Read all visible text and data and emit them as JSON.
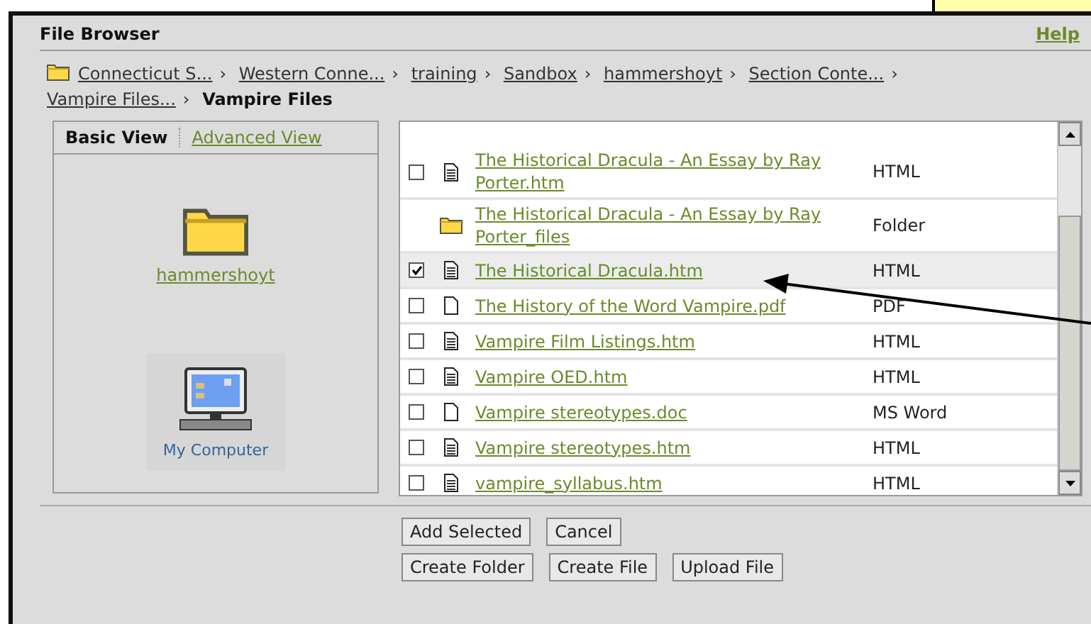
{
  "window": {
    "title": "File Browser",
    "help_link": "Help"
  },
  "breadcrumb": {
    "items": [
      "Connecticut S...",
      "Western Conne...",
      "training",
      "Sandbox",
      "hammershoyt",
      "Section Conte...",
      "Vampire Files..."
    ],
    "separators": [
      "›",
      "›",
      "›",
      "›",
      "›",
      "›",
      "›"
    ],
    "current": "Vampire Files"
  },
  "view_tabs": [
    {
      "label": "Basic View",
      "selected": true
    },
    {
      "label": "Advanced View",
      "selected": false
    }
  ],
  "places": [
    {
      "kind": "folder",
      "label": "hammershoyt"
    },
    {
      "kind": "computer",
      "label": "My Computer"
    }
  ],
  "files": [
    {
      "kind": "document",
      "name": "The Historical Dracula - An Essay by Ray Porter.htm",
      "type": "HTML",
      "checked": false
    },
    {
      "kind": "folder",
      "name": "The Historical Dracula - An Essay by Ray Porter_files",
      "type": "Folder"
    },
    {
      "kind": "document",
      "name": "The Historical Dracula.htm",
      "type": "HTML",
      "checked": true
    },
    {
      "kind": "blank",
      "name": "The History of the Word Vampire.pdf",
      "type": "PDF",
      "checked": false
    },
    {
      "kind": "document",
      "name": "Vampire Film Listings.htm",
      "type": "HTML",
      "checked": false
    },
    {
      "kind": "document",
      "name": "Vampire OED.htm",
      "type": "HTML",
      "checked": false
    },
    {
      "kind": "blank",
      "name": "Vampire stereotypes.doc",
      "type": "MS Word",
      "checked": false
    },
    {
      "kind": "document",
      "name": "Vampire stereotypes.htm",
      "type": "HTML",
      "checked": false
    },
    {
      "kind": "document",
      "name": "vampire_syllabus.htm",
      "type": "HTML",
      "checked": false
    }
  ],
  "buttons": [
    [
      "Add Selected",
      "Cancel"
    ],
    [
      "Create Folder",
      "Create File",
      "Upload File"
    ]
  ]
}
